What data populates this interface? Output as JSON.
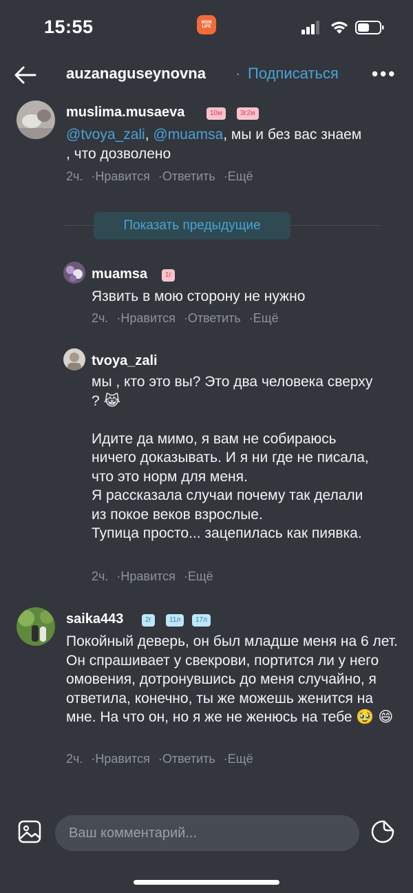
{
  "status": {
    "time": "15:55",
    "app_badge_text": "MOM LIFE"
  },
  "header": {
    "username": "auzanaguseynovna",
    "dot": "·",
    "subscribe": "Подписаться",
    "more": "•••"
  },
  "comments": [
    {
      "username": "muslima.musaeva",
      "badges": [
        "10м",
        "3г2м"
      ],
      "mention1": "@tvoya_zali",
      "comma": ", ",
      "mention2": "@muamsa",
      "text_after": ", мы и без вас знаем , что дозволено",
      "time": "2ч.",
      "like": "Нравится",
      "reply": "Ответить",
      "more": "Ещё"
    },
    {
      "username": "muamsa",
      "badges": [
        "1г"
      ],
      "text": "Язвить в мою сторону не нужно",
      "time": "2ч.",
      "like": "Нравится",
      "reply": "Ответить",
      "more": "Ещё"
    },
    {
      "username": "tvoya_zali",
      "badges": [],
      "text": "мы , кто это вы? Это два человека сверху ? 😹\n\nИдите да мимо,  я вам не собираюсь ничего доказывать. И я ни где не писала, что это норм для меня.\nЯ рассказала случаи почему так делали из покое веков взрослые.\nТупица просто... зацепилась как пиявка.",
      "time": "2ч.",
      "like": "Нравится",
      "more": "Ещё"
    },
    {
      "username": "saika443",
      "badges": [
        "2г",
        "11л",
        "17л"
      ],
      "text": "Покойный деверь, он был младше меня на 6 лет. Он спрашивает у свекрови, портится ли у него омовения, дотронувшись до меня случайно, я ответила, конечно, ты же можешь женится на мне. На что он, но я же не женюсь на тебе 🥹 😄",
      "time": "2ч.",
      "like": "Нравится",
      "reply": "Ответить",
      "more": "Ещё"
    }
  ],
  "show_previous": "Показать предыдущие",
  "composer": {
    "placeholder": "Ваш комментарий..."
  },
  "meta_sep": "·",
  "colors": {
    "background": "#33363d",
    "accent": "#4aa3d4",
    "badge_pink": "#f7c3cc",
    "badge_blue": "#bfe6f7"
  }
}
